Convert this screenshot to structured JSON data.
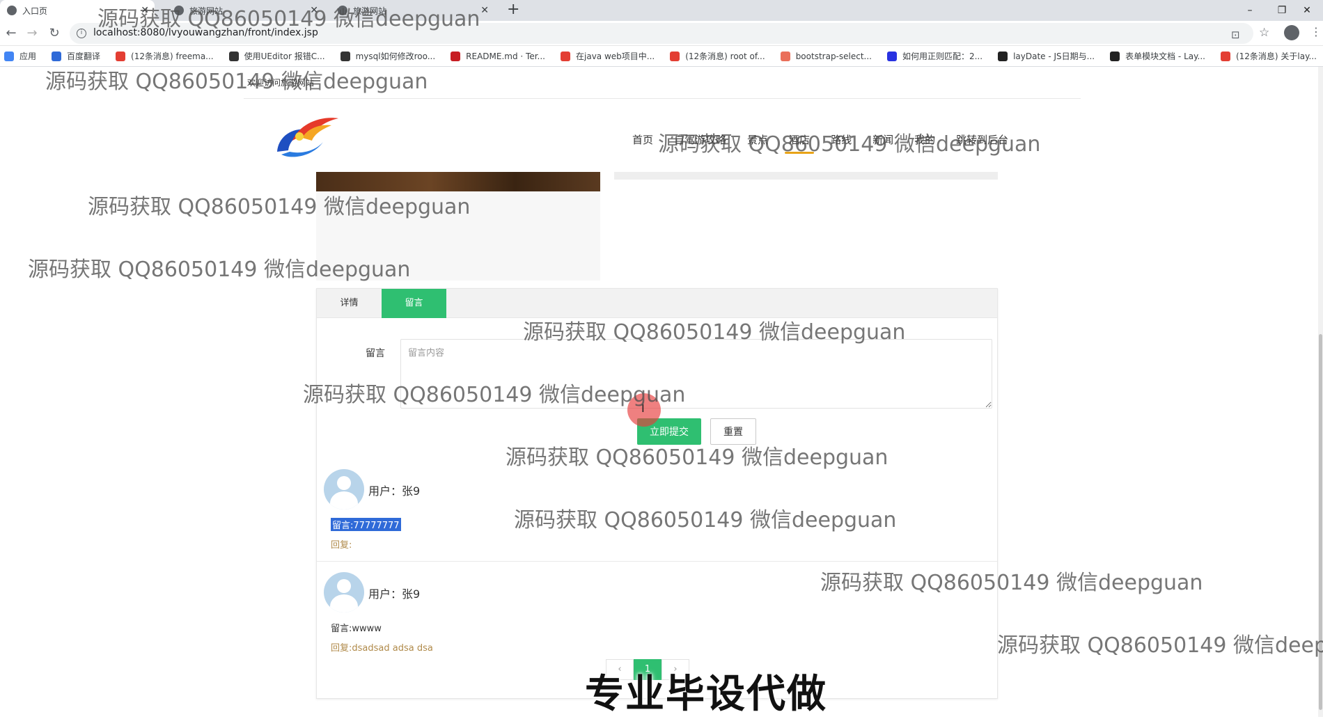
{
  "browser": {
    "tabs": [
      {
        "title": "入口页",
        "active": true
      },
      {
        "title": "旅游网站",
        "active": false
      },
      {
        "title": "旅游网站",
        "active": false
      }
    ],
    "new_tab_symbol": "+",
    "window_controls": {
      "minimize": "–",
      "maximize": "❐",
      "close": "✕"
    },
    "url": "localhost:8080/lvyouwangzhan/front/index.jsp",
    "bookmarks": [
      {
        "label": "应用",
        "icon": "apps-grid-icon",
        "color": "#4285f4"
      },
      {
        "label": "百度翻译",
        "icon": "baidu-translate-icon",
        "color": "#2f6ad8"
      },
      {
        "label": "(12条消息) freema...",
        "icon": "csdn-icon",
        "color": "#e33e33"
      },
      {
        "label": "使用UEditor 报错C...",
        "icon": "w-icon",
        "color": "#333333"
      },
      {
        "label": "mysql如何修改roo...",
        "icon": "w-icon",
        "color": "#333333"
      },
      {
        "label": "README.md · Ter...",
        "icon": "gitee-icon",
        "color": "#c71d23"
      },
      {
        "label": "在java web项目中...",
        "icon": "csdn-icon",
        "color": "#e33e33"
      },
      {
        "label": "(12条消息) root of...",
        "icon": "csdn-icon",
        "color": "#e33e33"
      },
      {
        "label": "bootstrap-select...",
        "icon": "jianshu-icon",
        "color": "#ea6f5a"
      },
      {
        "label": "如何用正则匹配：2...",
        "icon": "baidu-paw-icon",
        "color": "#2932e1"
      },
      {
        "label": "layDate - JS日期与...",
        "icon": "layui-icon",
        "color": "#222222"
      },
      {
        "label": "表单模块文档 - Lay...",
        "icon": "layui-icon",
        "color": "#222222"
      },
      {
        "label": "(12条消息) 关于lay...",
        "icon": "csdn-icon",
        "color": "#e33e33"
      }
    ]
  },
  "site": {
    "welcome": "欢迎访问旅游网站",
    "nav": [
      {
        "label": "首页",
        "active": false
      },
      {
        "label": "自驾游攻略",
        "active": false
      },
      {
        "label": "景点",
        "active": false
      },
      {
        "label": "酒店",
        "active": true
      },
      {
        "label": "路线",
        "active": false
      },
      {
        "label": "新闻",
        "active": false
      },
      {
        "label": "我的",
        "active": false
      },
      {
        "label": "跳转到后台",
        "active": false
      }
    ]
  },
  "detail": {
    "tabs": [
      {
        "label": "详情",
        "active": false
      },
      {
        "label": "留言",
        "active": true
      }
    ],
    "form": {
      "label": "留言",
      "placeholder": "留言内容",
      "submit_label": "立即提交",
      "reset_label": "重置"
    },
    "comments": [
      {
        "user_label": "用户：张9",
        "text": "留言:77777777",
        "reply": "回复:",
        "selected": true
      },
      {
        "user_label": "用户：张9",
        "text": "留言:wwww",
        "reply": "回复:dsadsad adsa dsa",
        "selected": false
      }
    ],
    "pagination": {
      "prev": "‹",
      "current": "1",
      "next": "›"
    }
  },
  "overlay": {
    "watermark": "源码获取 QQ86050149 微信deepguan",
    "banner": "专业毕设代做"
  },
  "colors": {
    "accent_green": "#2fbf71",
    "nav_active_underline": "#e8a317",
    "selection_blue": "#2f6ad8",
    "reply_brown": "#b08a4a"
  }
}
